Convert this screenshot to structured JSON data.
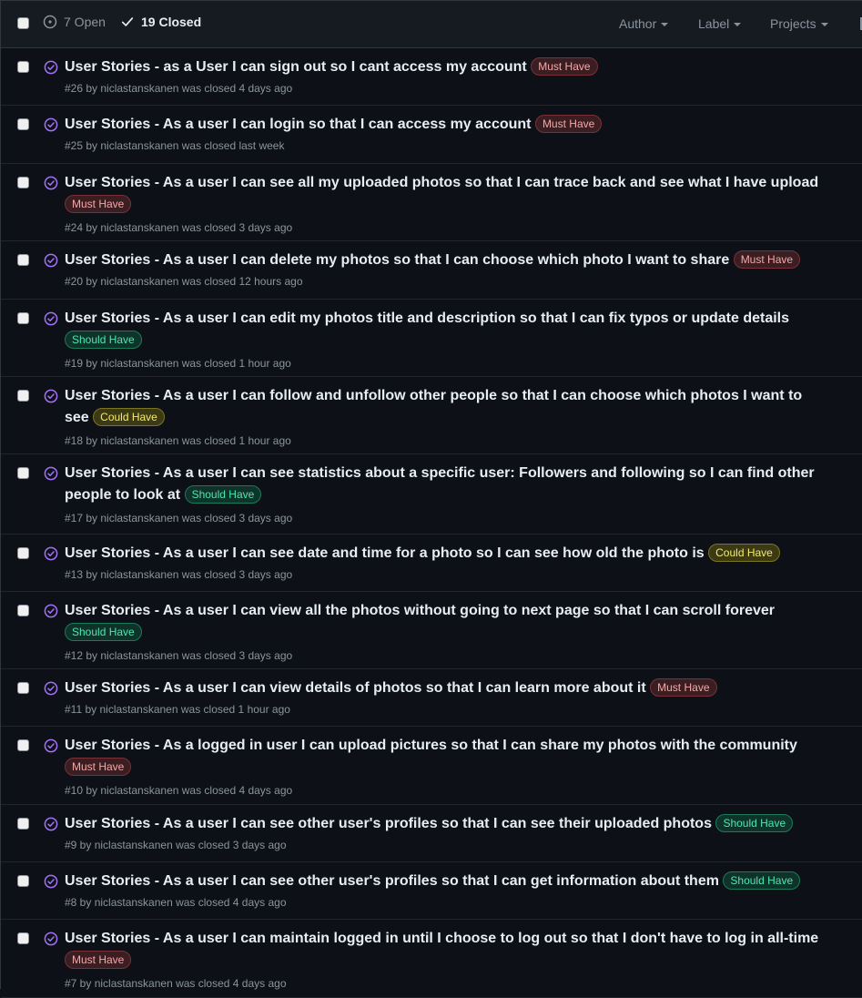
{
  "header": {
    "open_label": "7 Open",
    "closed_label": "19 Closed",
    "filters": [
      "Author",
      "Label",
      "Projects"
    ]
  },
  "colors": {
    "background": "#0d1117",
    "closed_icon": "#a371f7",
    "must_have": "#f6a7a7",
    "should_have": "#4ee6b2",
    "could_have": "#f4ea6c"
  },
  "issues": [
    {
      "title": "User Stories - as a User I can sign out so I cant access my account",
      "label": "Must Have",
      "meta": "#26 by niclastanskanen was closed 4 days ago"
    },
    {
      "title": "User Stories - As a user I can login so that I can access my account",
      "label": "Must Have",
      "meta": "#25 by niclastanskanen was closed last week"
    },
    {
      "title": "User Stories - As a user I can see all my uploaded photos so that I can trace back and see what I have upload",
      "label": "Must Have",
      "meta": "#24 by niclastanskanen was closed 3 days ago"
    },
    {
      "title": "User Stories - As a user I can delete my photos so that I can choose which photo I want to share",
      "label": "Must Have",
      "meta": "#20 by niclastanskanen was closed 12 hours ago"
    },
    {
      "title": "User Stories - As a user I can edit my photos title and description so that I can fix typos or update details",
      "label": "Should Have",
      "meta": "#19 by niclastanskanen was closed 1 hour ago"
    },
    {
      "title": "User Stories - As a user I can follow and unfollow other people so that I can choose which photos I want to see",
      "label": "Could Have",
      "meta": "#18 by niclastanskanen was closed 1 hour ago"
    },
    {
      "title": "User Stories - As a user I can see statistics about a specific user: Followers and following so I can find other people to look at",
      "label": "Should Have",
      "meta": "#17 by niclastanskanen was closed 3 days ago"
    },
    {
      "title": "User Stories - As a user I can see date and time for a photo so I can see how old the photo is",
      "label": "Could Have",
      "meta": "#13 by niclastanskanen was closed 3 days ago"
    },
    {
      "title": "User Stories - As a user I can view all the photos without going to next page so that I can scroll forever",
      "label": "Should Have",
      "meta": "#12 by niclastanskanen was closed 3 days ago"
    },
    {
      "title": "User Stories - As a user I can view details of photos so that I can learn more about it",
      "label": "Must Have",
      "meta": "#11 by niclastanskanen was closed 1 hour ago"
    },
    {
      "title": "User Stories - As a logged in user I can upload pictures so that I can share my photos with the community",
      "label": "Must Have",
      "meta": "#10 by niclastanskanen was closed 4 days ago"
    },
    {
      "title": "User Stories - As a user I can see other user's profiles so that I can see their uploaded photos",
      "label": "Should Have",
      "meta": "#9 by niclastanskanen was closed 3 days ago"
    },
    {
      "title": "User Stories - As a user I can see other user's profiles so that I can get information about them",
      "label": "Should Have",
      "meta": "#8 by niclastanskanen was closed 4 days ago"
    },
    {
      "title": "User Stories - As a user I can maintain logged in until I choose to log out so that I don't have to log in all-time",
      "label": "Must Have",
      "meta": "#7 by niclastanskanen was closed 4 days ago"
    }
  ]
}
